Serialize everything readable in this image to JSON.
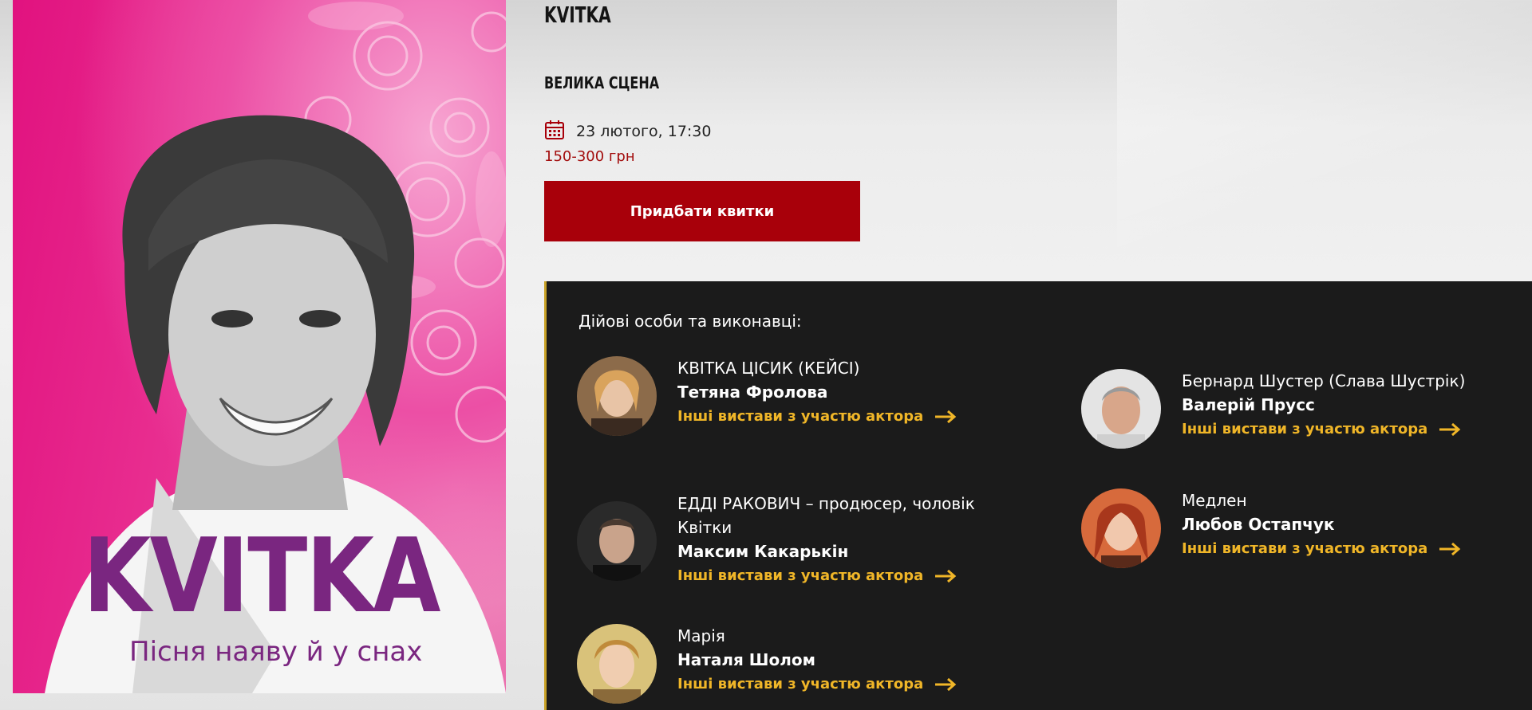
{
  "poster": {
    "title": "KVITKA",
    "subtitle": "Пісня наяву й у снах"
  },
  "show": {
    "title": "KVITKA",
    "stage": "ВЕЛИКА СЦЕНА",
    "date": "23 лютого, 17:30",
    "price": "150-300 грн",
    "buy_label": "Придбати квитки"
  },
  "cast": {
    "heading": "Дійові особи та виконавці:",
    "link_label": "Інші вистави з участю актора",
    "items": [
      {
        "role": "КВІТКА ЦІСИК (КЕЙСІ)",
        "actor": "Тетяна Фролова"
      },
      {
        "role": "Бернард Шустер (Слава Шустрік)",
        "actor": "Валерій Прусс"
      },
      {
        "role": "ЕДДІ РАКОВИЧ – продюсер, чоловік Квітки",
        "actor": "Максим Какарькін"
      },
      {
        "role": "Медлен",
        "actor": "Любов Остапчук"
      },
      {
        "role": "Марія",
        "actor": "Наталя Шолом"
      }
    ]
  },
  "colors": {
    "accent_red": "#a8000a",
    "price_red": "#a30d0d",
    "link_gold": "#f0b628",
    "panel_bg": "#1b1b1b",
    "poster_pink": "#e1127f",
    "poster_purple": "#7a2680"
  },
  "icons": {
    "calendar": "calendar-icon",
    "arrow": "arrow-right-icon"
  }
}
